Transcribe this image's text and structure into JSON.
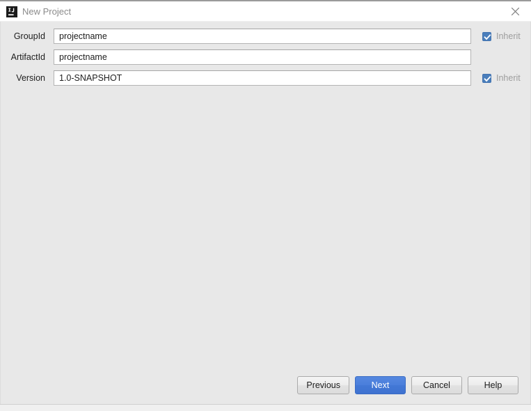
{
  "window": {
    "title": "New Project",
    "app_icon": "intellij-idea-icon",
    "close_icon": "close-icon",
    "background_color": "#e8e8e8",
    "titlebar_color": "#ffffff",
    "accent_color": "#4a7edb"
  },
  "form": {
    "rows": [
      {
        "label": "GroupId",
        "value": "projectname",
        "placeholder": "",
        "inherit": {
          "label": "Inherit",
          "checked": true,
          "enabled": false
        }
      },
      {
        "label": "ArtifactId",
        "value": "projectname",
        "placeholder": "",
        "inherit": null
      },
      {
        "label": "Version",
        "value": "1.0-SNAPSHOT",
        "placeholder": "",
        "inherit": {
          "label": "Inherit",
          "checked": true,
          "enabled": false
        }
      }
    ]
  },
  "footer": {
    "previous_label": "Previous",
    "next_label": "Next",
    "cancel_label": "Cancel",
    "help_label": "Help"
  }
}
